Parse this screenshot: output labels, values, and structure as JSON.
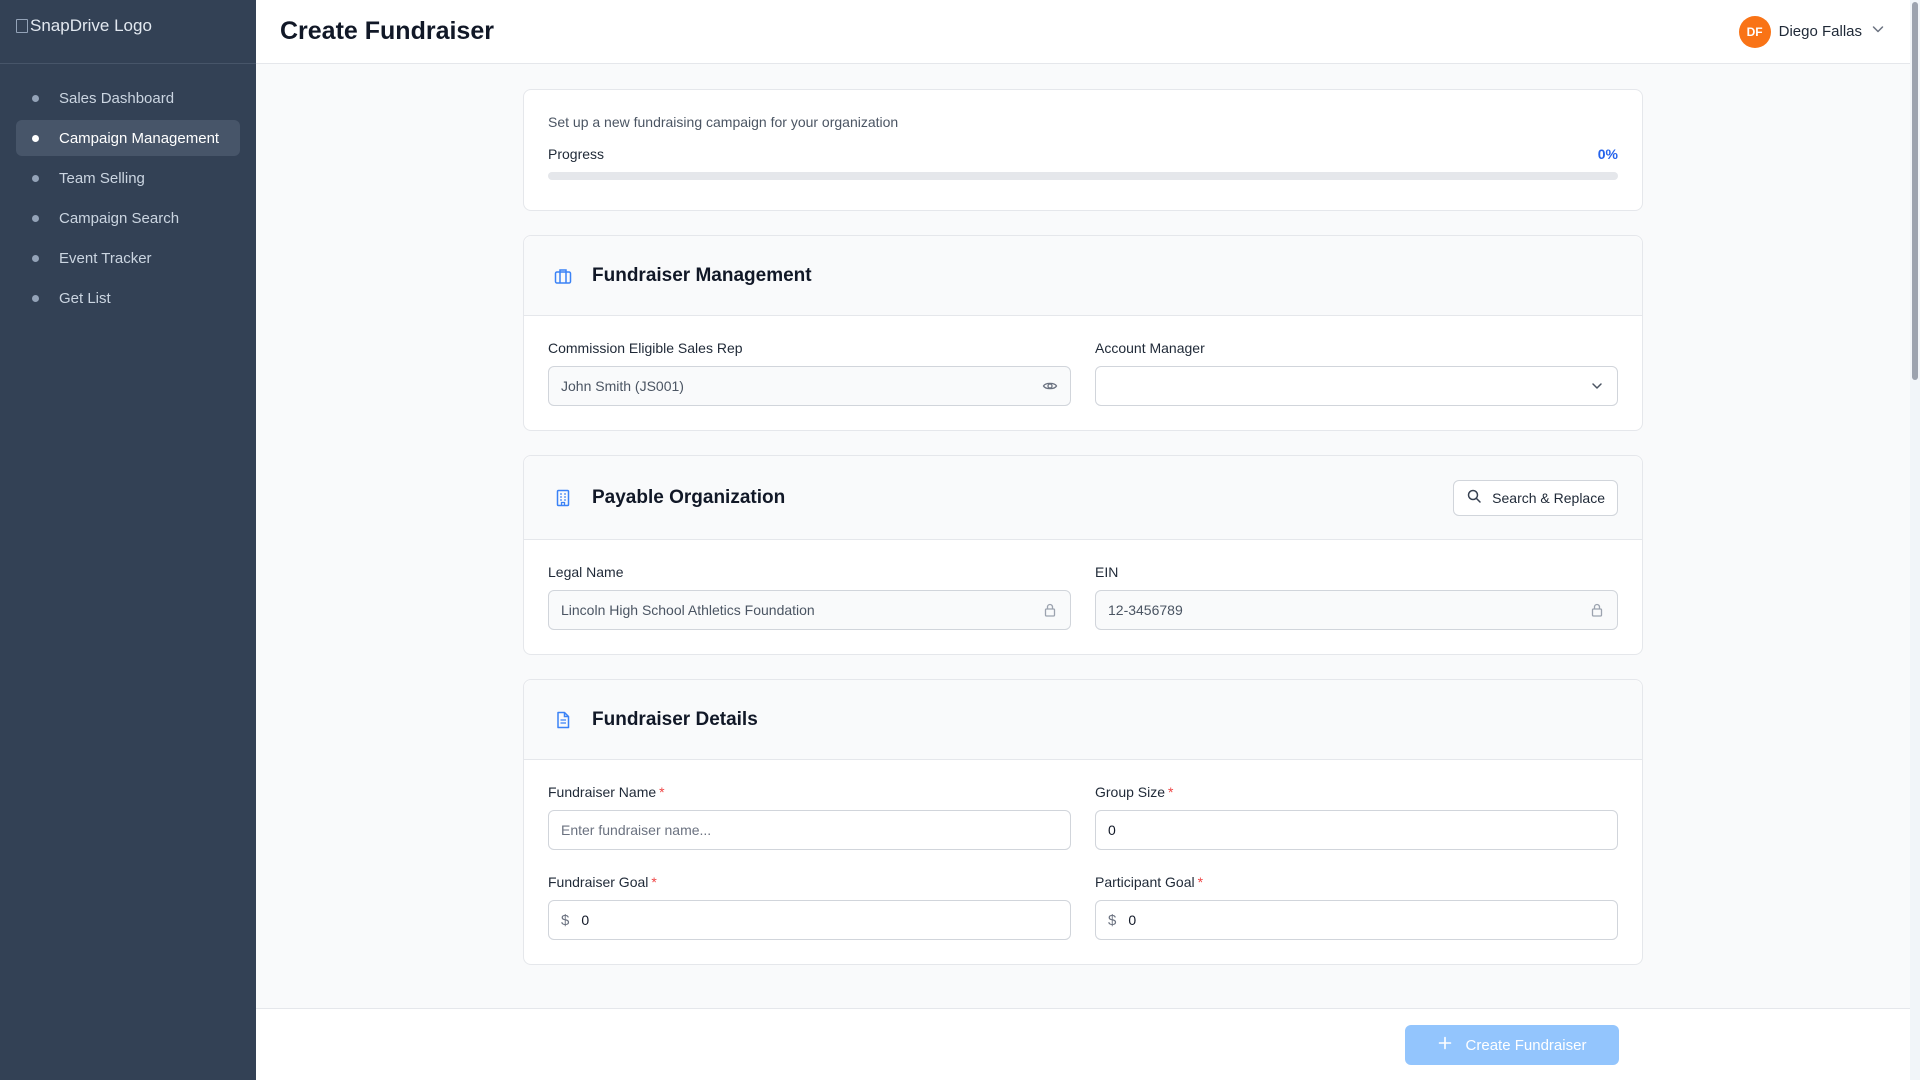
{
  "sidebar": {
    "logo_alt": "SnapDrive Logo",
    "items": [
      {
        "label": "Sales Dashboard"
      },
      {
        "label": "Campaign Management"
      },
      {
        "label": "Team Selling"
      },
      {
        "label": "Campaign Search"
      },
      {
        "label": "Event Tracker"
      },
      {
        "label": "Get List"
      }
    ],
    "active_index": 1
  },
  "header": {
    "title": "Create Fundraiser",
    "user": {
      "initials": "DF",
      "name": "Diego Fallas"
    }
  },
  "progress": {
    "subtitle": "Set up a new fundraising campaign for your organization",
    "label": "Progress",
    "value_text": "0%",
    "value": 0
  },
  "fundraiser_management": {
    "title": "Fundraiser Management",
    "icon": "briefcase-icon",
    "sales_rep": {
      "label": "Commission Eligible Sales Rep",
      "value": "John Smith (JS001)",
      "icon": "eye-icon"
    },
    "account_manager": {
      "label": "Account Manager",
      "value": "",
      "icon": "chevron-down-icon"
    }
  },
  "payable_organization": {
    "title": "Payable Organization",
    "icon": "building-icon",
    "search_button": "Search & Replace",
    "legal_name": {
      "label": "Legal Name",
      "value": "Lincoln High School Athletics Foundation",
      "icon": "lock-icon"
    },
    "ein": {
      "label": "EIN",
      "value": "12-3456789",
      "icon": "lock-icon"
    }
  },
  "fundraiser_details": {
    "title": "Fundraiser Details",
    "icon": "document-icon",
    "required_marker": "*",
    "name": {
      "label": "Fundraiser Name",
      "placeholder": "Enter fundraiser name..."
    },
    "group_size": {
      "label": "Group Size",
      "value": "0"
    },
    "goal": {
      "label": "Fundraiser Goal",
      "prefix": "$",
      "value": "0"
    },
    "participant_goal": {
      "label": "Participant Goal",
      "prefix": "$",
      "value": "0"
    }
  },
  "footer": {
    "create_button": "Create Fundraiser"
  },
  "colors": {
    "sidebar_bg": "#334155",
    "accent": "#2563eb",
    "primary_button": "#93c5fd",
    "avatar": "#f97316",
    "required": "#ef4444"
  }
}
